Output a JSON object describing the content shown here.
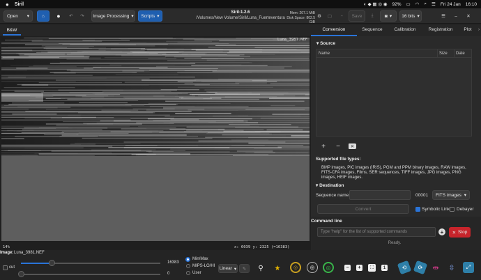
{
  "menubar": {
    "app": "Siril",
    "battery": "92%",
    "date": "Fri 24 Jan",
    "time": "16:10"
  },
  "toolbar": {
    "open": "Open",
    "image_processing": "Image Processing",
    "scripts": "Scripts",
    "title": "Siril-1.2.6",
    "path": "/Volumes/New Volume/Siril/Luna_Fuerteventura",
    "mem": "Mem: 207.1 MiB",
    "disk": "Disk Space: 802.5 GiB",
    "save": "Save",
    "bits": "16 bits"
  },
  "left": {
    "tab": "B&W",
    "image_filename_overlay": "Luna_3981.NEF",
    "zoom": "14%",
    "coords": "x: 6039 y: 2325 (=16383)"
  },
  "bottom": {
    "image_label": "Image:",
    "image_file": "Luna_3981.NEF",
    "hi_value": "16383",
    "lo_value": "0",
    "cut_label": "cut",
    "radio_minmax": "Min/Max",
    "radio_mips": "MIPS-LO/HI",
    "radio_user": "User",
    "stretch": "Linear",
    "hi_frac": 0.22,
    "lo_frac": 0.0
  },
  "right": {
    "tabs": [
      "Conversion",
      "Sequence",
      "Calibration",
      "Registration",
      "Plot"
    ],
    "source_title": "Source",
    "col_name": "Name",
    "col_size": "Size",
    "col_date": "Date",
    "supported_title": "Supported file types:",
    "supported_text": "BMP images, PIC images (IRIS), PGM and PPM binary images, RAW images, FITS-CFA images, Films, SER sequences, TIFF images, JPG images, PNG images, HEIF images.",
    "destination_title": "Destination",
    "seq_name_label": "Sequence name:",
    "seq_name_value": "",
    "seq_number": "00001",
    "format": "FITS images",
    "convert": "Convert",
    "symbolic_link": "Symbolic Link",
    "debayer": "Debayer",
    "cmdline_title": "Command line",
    "cmd_placeholder": "Type \"help\" for the list of supported commands",
    "stop": "Stop",
    "status": "Ready."
  },
  "colors": {
    "accent": "#2a74d8",
    "stop": "#c8242b"
  }
}
